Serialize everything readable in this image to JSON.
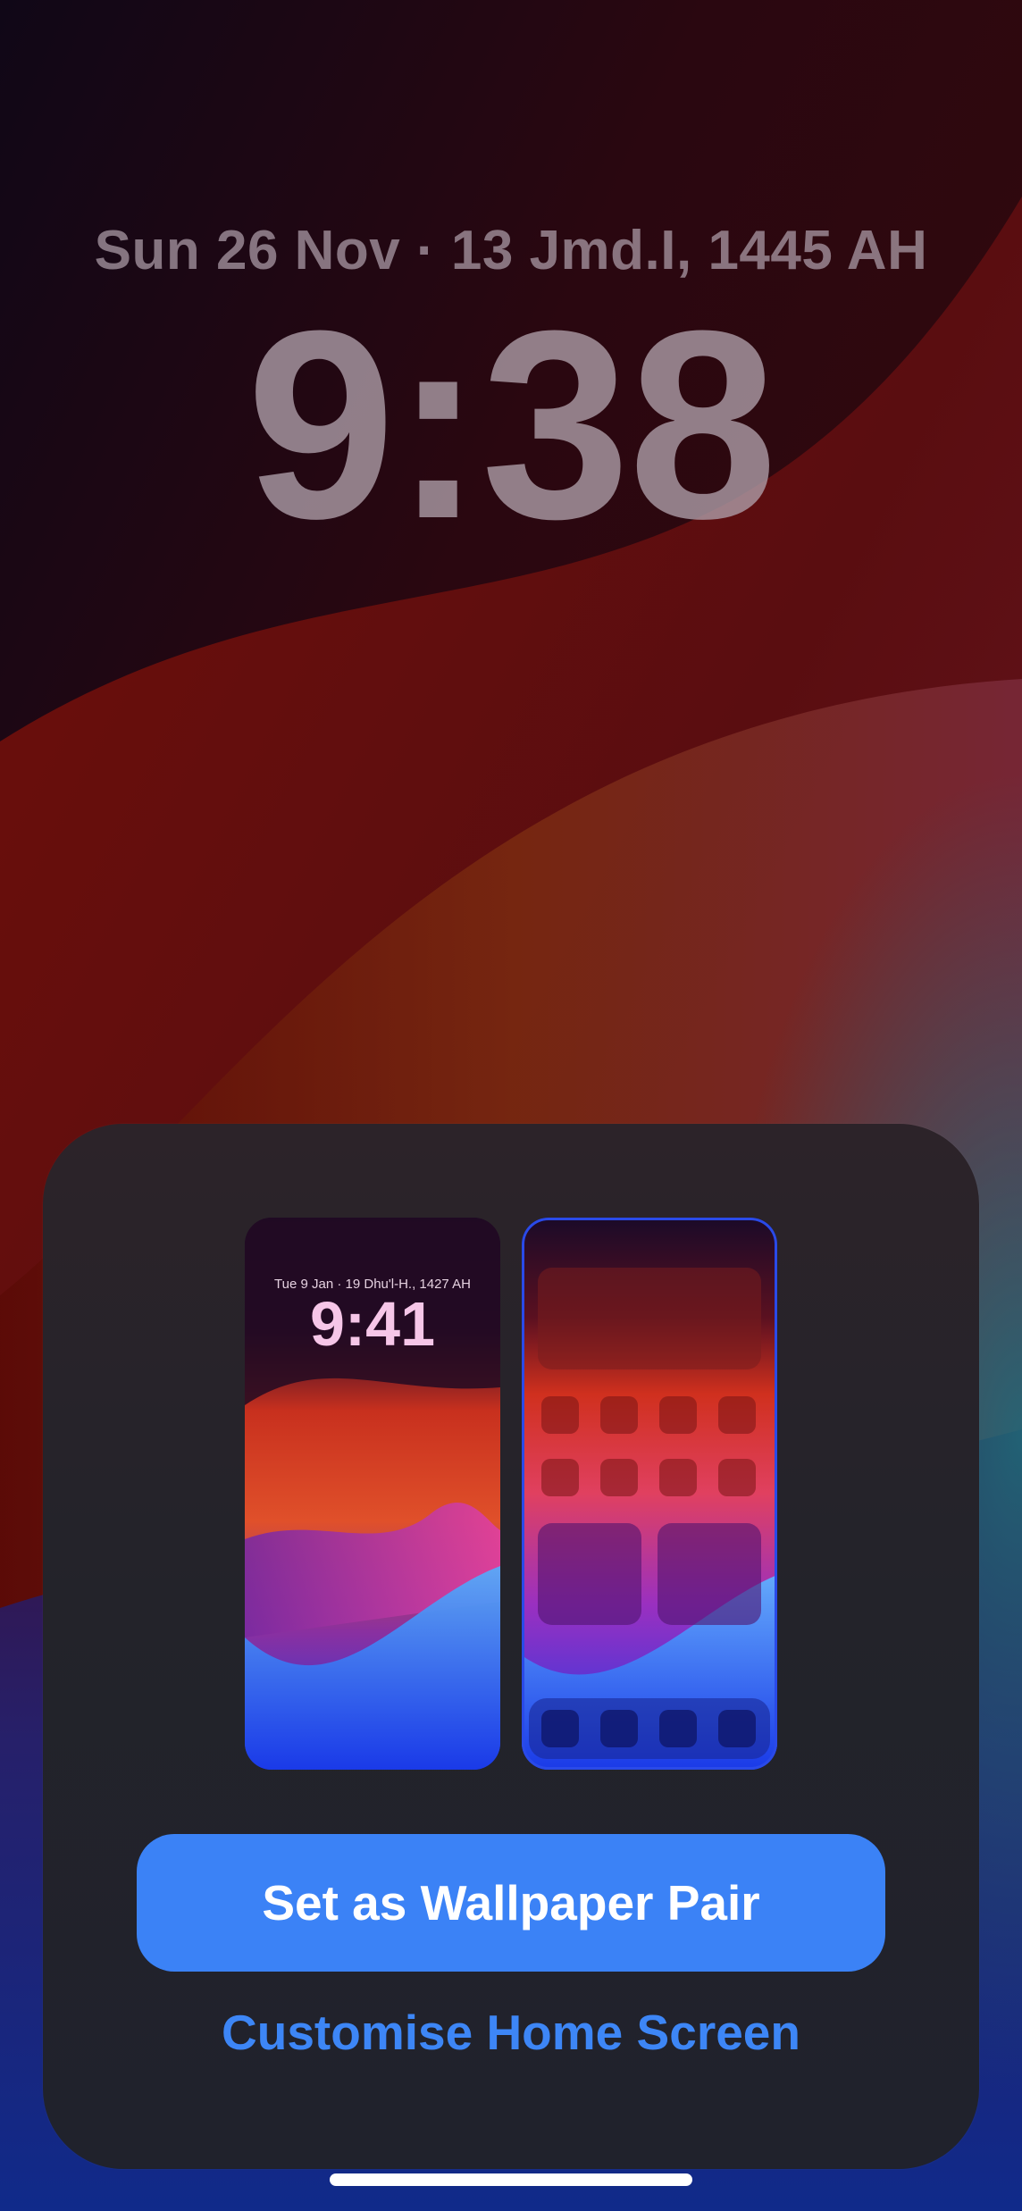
{
  "lock_screen": {
    "date": "Sun 26 Nov · 13 Jmd.I, 1445 AH",
    "time": "9:38"
  },
  "sheet": {
    "lock_preview": {
      "date": "Tue 9 Jan · 19 Dhu'l-H., 1427 AH",
      "time": "9:41"
    },
    "home_preview": {
      "icon_rows": 2,
      "icons_per_row": 4,
      "dock_icons": 4
    },
    "primary_button_label": "Set as Wallpaper Pair",
    "secondary_button_label": "Customise Home Screen"
  },
  "colors": {
    "accent": "#3b82f6",
    "link": "#3d86f6",
    "sheet_background": "#23232a"
  }
}
